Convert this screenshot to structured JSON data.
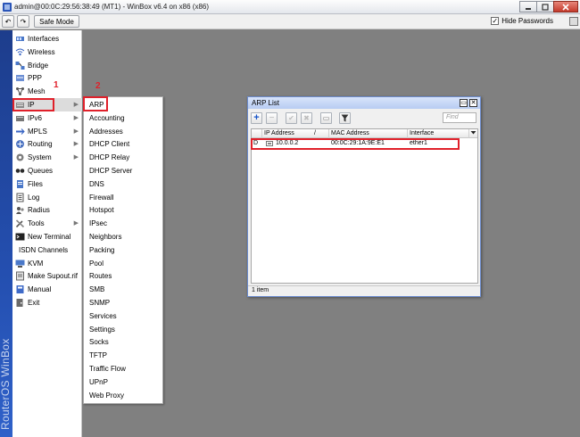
{
  "window": {
    "title": "admin@00:0C:29:56:38:49 (MT1) - WinBox v6.4 on x86 (x86)",
    "minimize_label": "_",
    "maximize_label": "□",
    "close_label": "✕"
  },
  "toolbar": {
    "undo_label": "↶",
    "redo_label": "↷",
    "safe_mode_label": "Safe Mode",
    "hide_passwords_label": "Hide Passwords",
    "hide_passwords_checked": true,
    "check_mark": "✓"
  },
  "brand": {
    "vertical_text": "RouterOS WinBox"
  },
  "sidebar": {
    "items": [
      {
        "label": "Interfaces",
        "icon": "interfaces-icon",
        "has_submenu": false
      },
      {
        "label": "Wireless",
        "icon": "wireless-icon",
        "has_submenu": false
      },
      {
        "label": "Bridge",
        "icon": "bridge-icon",
        "has_submenu": false
      },
      {
        "label": "PPP",
        "icon": "ppp-icon",
        "has_submenu": false
      },
      {
        "label": "Mesh",
        "icon": "mesh-icon",
        "has_submenu": false
      },
      {
        "label": "IP",
        "icon": "ip-icon",
        "has_submenu": true,
        "selected": true
      },
      {
        "label": "IPv6",
        "icon": "ipv6-icon",
        "has_submenu": true
      },
      {
        "label": "MPLS",
        "icon": "mpls-icon",
        "has_submenu": true
      },
      {
        "label": "Routing",
        "icon": "routing-icon",
        "has_submenu": true
      },
      {
        "label": "System",
        "icon": "system-icon",
        "has_submenu": true
      },
      {
        "label": "Queues",
        "icon": "queues-icon",
        "has_submenu": false
      },
      {
        "label": "Files",
        "icon": "files-icon",
        "has_submenu": false
      },
      {
        "label": "Log",
        "icon": "log-icon",
        "has_submenu": false
      },
      {
        "label": "Radius",
        "icon": "radius-icon",
        "has_submenu": false
      },
      {
        "label": "Tools",
        "icon": "tools-icon",
        "has_submenu": true
      },
      {
        "label": "New Terminal",
        "icon": "terminal-icon",
        "has_submenu": false
      },
      {
        "label": "ISDN Channels",
        "icon": "",
        "has_submenu": false
      },
      {
        "label": "KVM",
        "icon": "kvm-icon",
        "has_submenu": false
      },
      {
        "label": "Make Supout.rif",
        "icon": "supout-icon",
        "has_submenu": false
      },
      {
        "label": "Manual",
        "icon": "manual-icon",
        "has_submenu": false
      },
      {
        "label": "Exit",
        "icon": "exit-icon",
        "has_submenu": false
      }
    ],
    "submenu_arrow": "▶"
  },
  "ip_submenu": {
    "items": [
      "ARP",
      "Accounting",
      "Addresses",
      "DHCP Client",
      "DHCP Relay",
      "DHCP Server",
      "DNS",
      "Firewall",
      "Hotspot",
      "IPsec",
      "Neighbors",
      "Packing",
      "Pool",
      "Routes",
      "SMB",
      "SNMP",
      "Services",
      "Settings",
      "Socks",
      "TFTP",
      "Traffic Flow",
      "UPnP",
      "Web Proxy"
    ]
  },
  "annotations": {
    "step1": "1",
    "step2": "2"
  },
  "arp_window": {
    "title": "ARP List",
    "find_placeholder": "Find",
    "add_label": "+",
    "remove_label": "−",
    "enable_label": "✔",
    "disable_label": "✖",
    "comment_label": "▭",
    "filter_label": "▼",
    "restore_label": "▭",
    "close_label": "✕",
    "columns": [
      "",
      "IP Address",
      "/",
      "MAC Address",
      "Interface"
    ],
    "rows": [
      {
        "flag": "D",
        "ip": "10.0.0.2",
        "mac": "00:0C:29:1A:9E:E1",
        "interface": "ether1"
      }
    ],
    "status": "1 item"
  },
  "colors": {
    "accent": "#244fb0",
    "annotation_red": "#e0202a",
    "add_blue": "#1553c8",
    "desktop": "#808080"
  }
}
